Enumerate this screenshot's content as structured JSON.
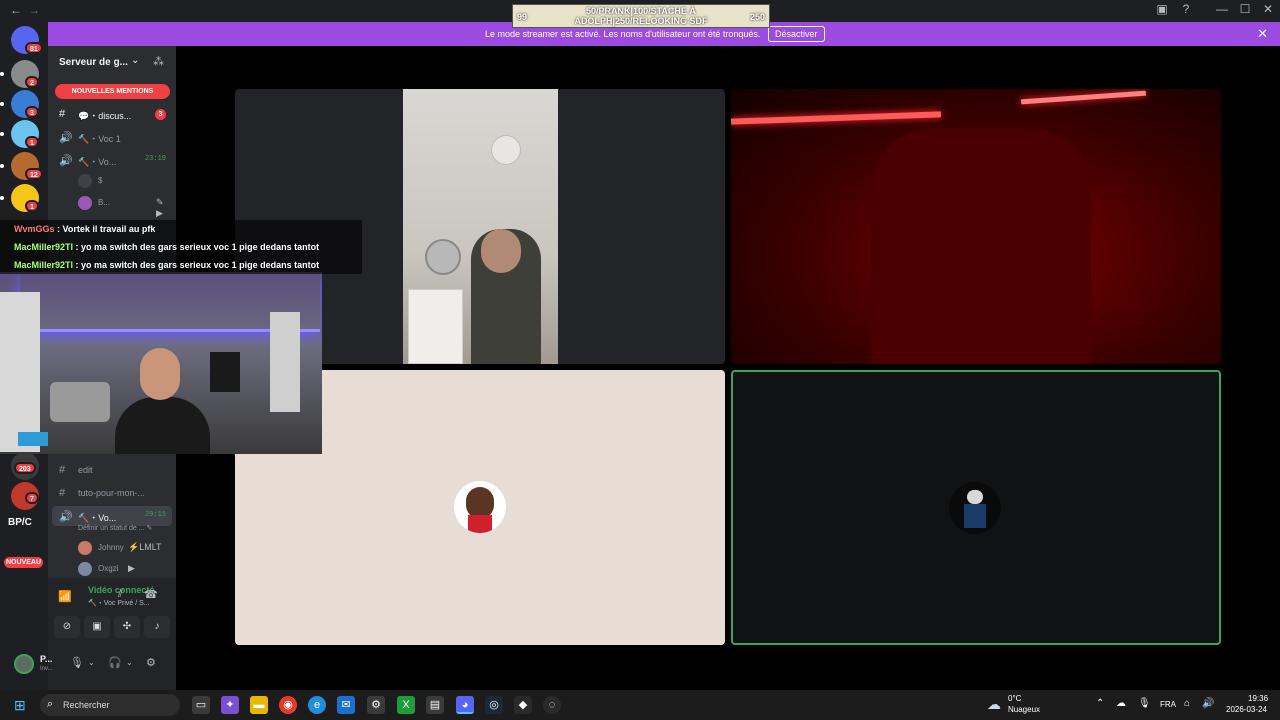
{
  "title_bar": {
    "back_icon": "arrow-left-icon",
    "forward_icon": "arrow-right-icon",
    "controls": [
      "screen-icon",
      "help-icon",
      "minimize-icon",
      "maximize-icon",
      "close-icon"
    ],
    "minimize": "—",
    "maximize": "☐",
    "close": "✕"
  },
  "goal_overlay": {
    "left_value": "99",
    "center_line1": "50/PRANK|100/STACHE À",
    "center_line2": "ADOLPH|250/RELOOKING SDF",
    "right_value": "250"
  },
  "banner": {
    "message": "Le mode streamer est activé. Les noms d'utilisateur ont été tronqués.",
    "button": "Désactiver",
    "close": "✕"
  },
  "servers": [
    {
      "badge": "81",
      "color": "#5865f2"
    },
    {
      "badge": "2",
      "color": "#8a8a8a"
    },
    {
      "badge": "3",
      "color": "#3a7bd5"
    },
    {
      "badge": "1",
      "color": "#6cc3f0"
    },
    {
      "badge": "12",
      "color": "#b56b2e"
    },
    {
      "badge": "1",
      "color": "#f5c518"
    }
  ],
  "lower_servers": [
    {
      "badge": "203",
      "color": "#3a3a3a"
    },
    {
      "badge": "7",
      "color": "#c0392b"
    }
  ],
  "bpc_label": "BP/C",
  "nouveau_label": "NOUVEAU",
  "sidebar": {
    "server_name": "Serveur de g...",
    "new_mentions": "NOUVELLES MENTIONS",
    "channels_top": [
      {
        "icon": "#",
        "name": "💬・discus...",
        "count": "3",
        "unread": true
      },
      {
        "icon": "🔊",
        "name": "🔨・Voc 1"
      },
      {
        "icon": "🔊",
        "name": "🔨・Vo...",
        "time": "23:19"
      }
    ],
    "users_top": [
      {
        "name": "$",
        "color": "#3f4147"
      },
      {
        "name": "B...",
        "color": "#9b59b6",
        "icons": "✎ ▶"
      }
    ],
    "channels_bottom": [
      {
        "icon": "#",
        "name": "edit"
      },
      {
        "icon": "#",
        "name": "tuto-pour-mon-..."
      },
      {
        "icon": "🔊",
        "name": "🔨・Vo...",
        "time": "29:11",
        "active": true
      }
    ],
    "status_text": "Définir un statut de ... ✎",
    "users_bottom": [
      {
        "name": "Johnny",
        "extra": "⚡LMLT",
        "color": "#c97a6b"
      },
      {
        "name": "Oxgzi",
        "extra": "▶",
        "color": "#7a8aa0"
      }
    ]
  },
  "voice_panel": {
    "title": "Vidéo connecté",
    "subtitle": "🔨・Voc Privé / S...",
    "buttons": [
      "camera-off-icon",
      "screen-share-icon",
      "activities-icon",
      "soundboard-icon"
    ]
  },
  "user_panel": {
    "name": "P...",
    "sub": "Inv..."
  },
  "chat": [
    {
      "nick": "WvmGGs",
      "text": " : Vortek il travail au pfk",
      "red": true
    },
    {
      "nick": "MacMiller92Tl",
      "text": " : yo ma switch des gars serieux voc 1 pige dedans tantot"
    },
    {
      "nick": "MacMiller92Tl",
      "text": " : yo ma switch des gars serieux voc 1 pige dedans tantot"
    }
  ],
  "taskbar": {
    "search": "Rechercher",
    "temperature": "0°C",
    "condition": "Nuageux",
    "language": "FRA",
    "time": "19:36",
    "date": "2026-03-24"
  }
}
